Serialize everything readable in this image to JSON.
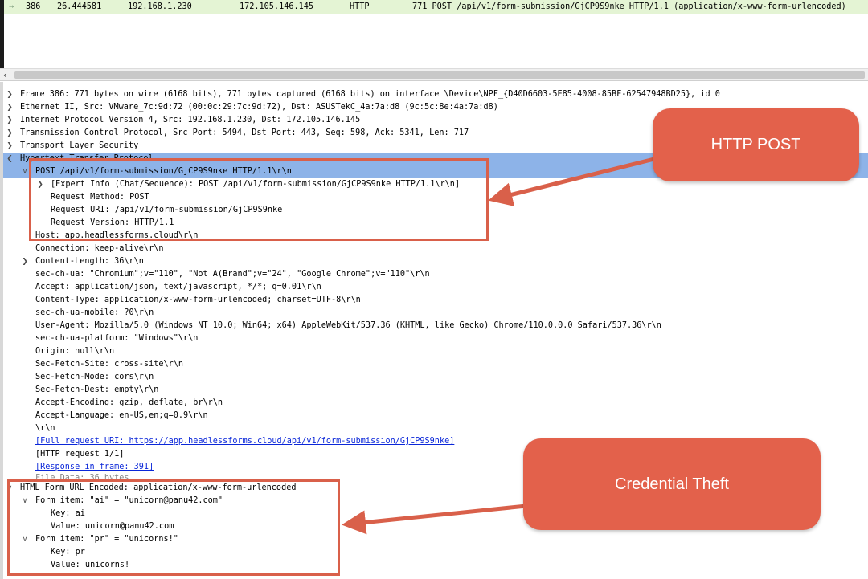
{
  "packet_list": {
    "row": {
      "no": "386",
      "time": "26.444581",
      "source": "192.168.1.230",
      "destination": "172.105.146.145",
      "protocol": "HTTP",
      "info": "771 POST /api/v1/form-submission/GjCP9S9nke HTTP/1.1  (application/x-www-form-urlencoded)"
    }
  },
  "detail": {
    "frame": "Frame 386: 771 bytes on wire (6168 bits), 771 bytes captured (6168 bits) on interface \\Device\\NPF_{D40D6603-5E85-4008-85BF-62547948BD25}, id 0",
    "ethernet": "Ethernet II, Src: VMware_7c:9d:72 (00:0c:29:7c:9d:72), Dst: ASUSTekC_4a:7a:d8 (9c:5c:8e:4a:7a:d8)",
    "ip": "Internet Protocol Version 4, Src: 192.168.1.230, Dst: 172.105.146.145",
    "tcp": "Transmission Control Protocol, Src Port: 5494, Dst Port: 443, Seq: 598, Ack: 5341, Len: 717",
    "tls": "Transport Layer Security",
    "http": "Hypertext Transfer Protocol",
    "request_line": "POST /api/v1/form-submission/GjCP9S9nke HTTP/1.1\\r\\n",
    "expert_info": "[Expert Info (Chat/Sequence): POST /api/v1/form-submission/GjCP9S9nke HTTP/1.1\\r\\n]",
    "request_method": "Request Method: POST",
    "request_uri": "Request URI: /api/v1/form-submission/GjCP9S9nke",
    "request_version": "Request Version: HTTP/1.1",
    "host": "Host: app.headlessforms.cloud\\r\\n",
    "connection": "Connection: keep-alive\\r\\n",
    "content_length": "Content-Length: 36\\r\\n",
    "sec_ch_ua": "sec-ch-ua: \"Chromium\";v=\"110\", \"Not A(Brand\";v=\"24\", \"Google Chrome\";v=\"110\"\\r\\n",
    "accept": "Accept: application/json, text/javascript, */*; q=0.01\\r\\n",
    "content_type": "Content-Type: application/x-www-form-urlencoded; charset=UTF-8\\r\\n",
    "sec_ch_ua_mobile": "sec-ch-ua-mobile: ?0\\r\\n",
    "user_agent": "User-Agent: Mozilla/5.0 (Windows NT 10.0; Win64; x64) AppleWebKit/537.36 (KHTML, like Gecko) Chrome/110.0.0.0 Safari/537.36\\r\\n",
    "sec_ch_ua_platform": "sec-ch-ua-platform: \"Windows\"\\r\\n",
    "origin": "Origin: null\\r\\n",
    "sec_fetch_site": "Sec-Fetch-Site: cross-site\\r\\n",
    "sec_fetch_mode": "Sec-Fetch-Mode: cors\\r\\n",
    "sec_fetch_dest": "Sec-Fetch-Dest: empty\\r\\n",
    "accept_encoding": "Accept-Encoding: gzip, deflate, br\\r\\n",
    "accept_language": "Accept-Language: en-US,en;q=0.9\\r\\n",
    "crlf": "\\r\\n",
    "full_request_uri": "[Full request URI: https://app.headlessforms.cloud/api/v1/form-submission/GjCP9S9nke]",
    "http_request": "[HTTP request 1/1]",
    "response_in_frame": "[Response in frame: 391]",
    "file_data": "File Data: 36 bytes",
    "form_urlencoded": "HTML Form URL Encoded: application/x-www-form-urlencoded",
    "form_item_ai": "Form item: \"ai\" = \"unicorn@panu42.com\"",
    "key_ai": "Key: ai",
    "value_ai": "Value: unicorn@panu42.com",
    "form_item_pr": "Form item: \"pr\" = \"unicorns!\"",
    "key_pr": "Key: pr",
    "value_pr": "Value: unicorns!"
  },
  "callouts": {
    "http_post": "HTTP POST",
    "credential_theft": "Credential Theft"
  },
  "colors": {
    "callout": "#e3614b",
    "highlight_border": "#d9604a",
    "selected_row": "#8db3e8",
    "packet_row": "#e4f4d4"
  }
}
